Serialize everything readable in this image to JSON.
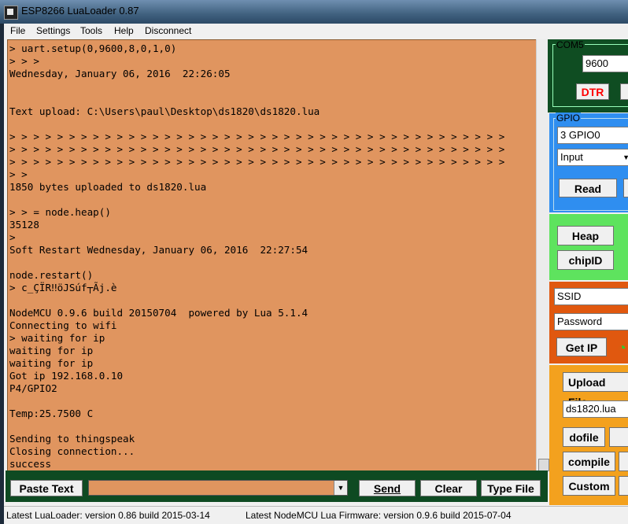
{
  "window": {
    "title": "ESP8266 LuaLoader 0.87"
  },
  "menu": [
    "File",
    "Settings",
    "Tools",
    "Help",
    "Disconnect"
  ],
  "console": {
    "lines": [
      "> uart.setup(0,9600,8,0,1,0)",
      "> > >",
      "Wednesday, January 06, 2016  22:26:05",
      "",
      "",
      "Text upload: C:\\Users\\paul\\Desktop\\ds1820\\ds1820.lua",
      "",
      "> > > > > > > > > > > > > > > > > > > > > > > > > > > > > > > > > > > > > > > > > >",
      "> > > > > > > > > > > > > > > > > > > > > > > > > > > > > > > > > > > > > > > > > >",
      "> > > > > > > > > > > > > > > > > > > > > > > > > > > > > > > > > > > > > > > > > >",
      "> >",
      "1850 bytes uploaded to ds1820.lua",
      "",
      "> > = node.heap()",
      "35128",
      ">",
      "Soft Restart Wednesday, January 06, 2016  22:27:54",
      "",
      "node.restart()",
      "> c_ÇÏR‼öJSúf┬Ãj.è",
      "",
      "NodeMCU 0.9.6 build 20150704  powered by Lua 5.1.4",
      "Connecting to wifi",
      "> waiting for ip",
      "waiting for ip",
      "waiting for ip",
      "Got ip 192.168.0.10",
      "P4/GPIO2",
      "",
      "Temp:25.7500 C",
      "",
      "Sending to thingspeak",
      "Closing connection...",
      "success"
    ]
  },
  "bottom": {
    "paste": "Paste Text",
    "send": "Send",
    "clear": "Clear",
    "typefile": "Type File",
    "command_value": ""
  },
  "status": {
    "left": "Latest LuaLoader:  version 0.86  build 2015-03-14",
    "right": "Latest NodeMCU Lua Firmware:  version 0.9.6 build 2015-07-04"
  },
  "com": {
    "label": "COM5",
    "baud": "9600",
    "dtr": "DTR"
  },
  "gpio": {
    "label": "GPIO",
    "pin": "3 GPIO0",
    "mode": "Input",
    "read": "Read"
  },
  "info": {
    "heap": "Heap",
    "chipid": "chipID"
  },
  "wifi": {
    "ssid": "SSID",
    "password": "Password",
    "getip": "Get IP"
  },
  "files": {
    "upload": "Upload File...",
    "filename": "ds1820.lua",
    "dofile": "dofile",
    "compile": "compile",
    "custom": "Custom"
  },
  "colors": {
    "console_bg": "#e0955f",
    "com_panel": "#0f4d22",
    "gpio_panel": "#2f8ef0",
    "info_panel": "#5ee35e",
    "wifi_panel": "#e0580f",
    "files_panel": "#f3a11e",
    "dtr_text": "#ff0000"
  },
  "scrollbar": {
    "position": 0.97
  }
}
